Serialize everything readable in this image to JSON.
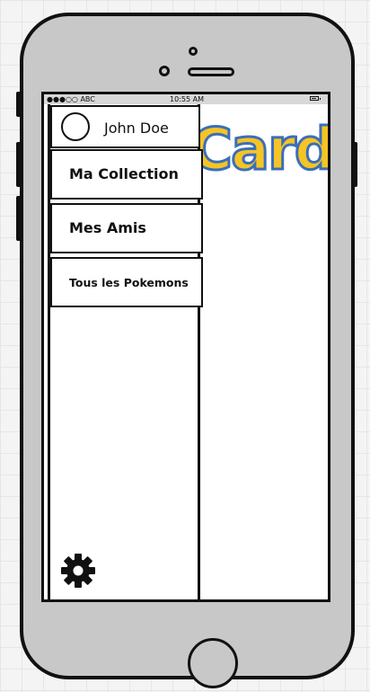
{
  "status_bar": {
    "carrier": "●●●○○ ABC",
    "time": "10:55 AM",
    "battery_icon": "battery-icon"
  },
  "app": {
    "logo_text": "Card",
    "logo_fill_color": "#f5c425",
    "logo_outline_color": "#3b6fb8"
  },
  "drawer": {
    "profile": {
      "name": "John Doe",
      "avatar_icon": "avatar-circle-icon"
    },
    "items": [
      {
        "label": "Ma Collection"
      },
      {
        "label": "Mes Amis"
      },
      {
        "label": "Tous les Pokemons"
      }
    ],
    "settings_icon": "gear-icon"
  }
}
